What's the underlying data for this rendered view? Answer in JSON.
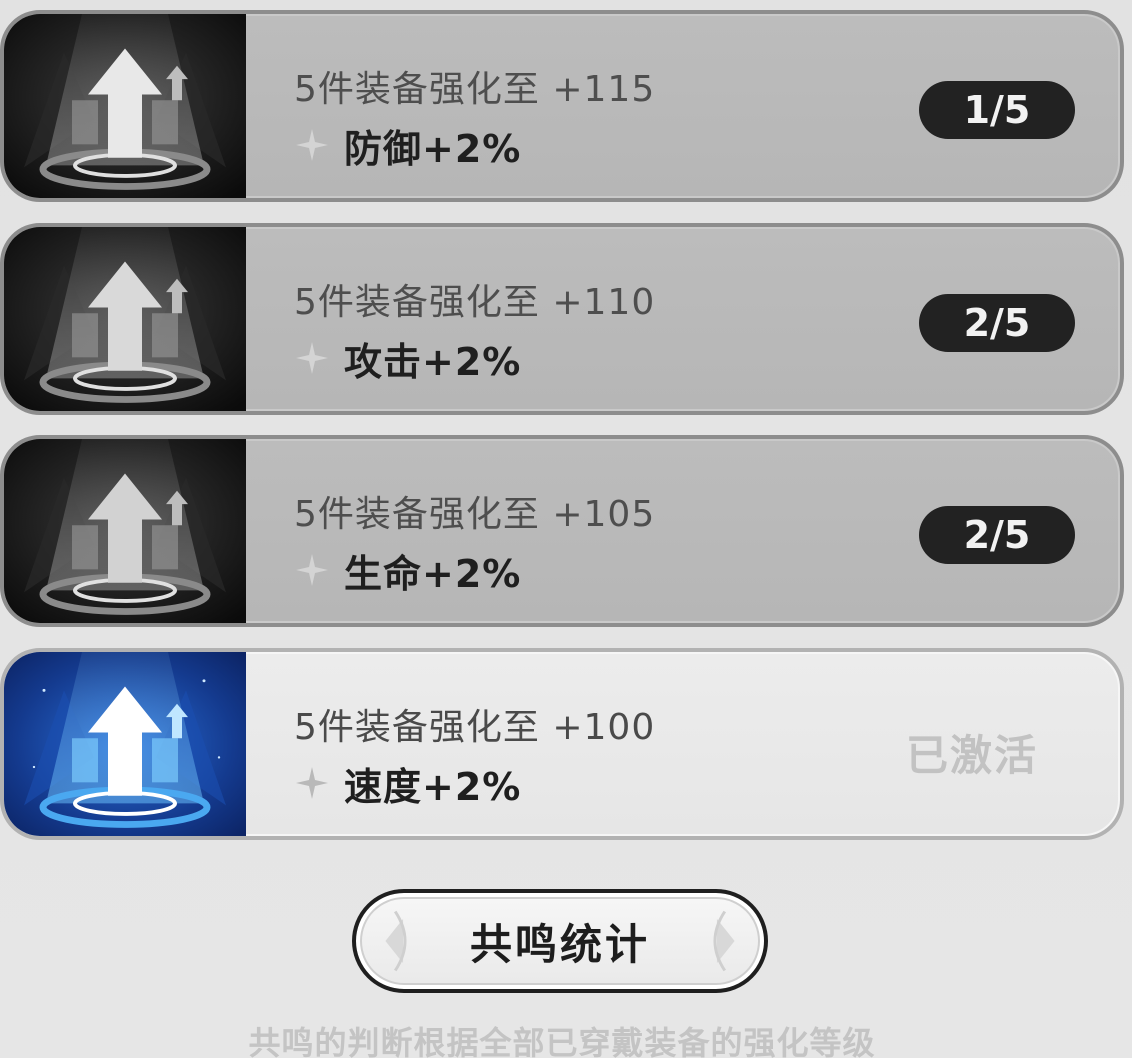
{
  "resonance": {
    "tiers": [
      {
        "requirement": "5件装备强化至 +115",
        "bonus": "防御+2%",
        "progress": "1/5",
        "progress_fraction": 0.2,
        "state": "locked"
      },
      {
        "requirement": "5件装备强化至 +110",
        "bonus": "攻击+2%",
        "progress": "2/5",
        "progress_fraction": 0.4,
        "state": "locked"
      },
      {
        "requirement": "5件装备强化至 +105",
        "bonus": "生命+2%",
        "progress": "2/5",
        "progress_fraction": 0.4,
        "state": "locked"
      },
      {
        "requirement": "5件装备强化至 +100",
        "bonus": "速度+2%",
        "status": "已激活",
        "state": "active"
      }
    ],
    "stats_button_label": "共鸣统计",
    "footnote": "共鸣的判断根据全部已穿戴装备的强化等级",
    "icons": {
      "locked": "upgrade-arrow-icon-gray",
      "active": "upgrade-arrow-icon-blue",
      "bullet": "sparkle-icon"
    },
    "colors": {
      "locked_icon_bg": "#1a1a1a",
      "active_icon_bg": "#123a8c",
      "pill_bg": "#222222",
      "activated_text": "#c2c2c2"
    }
  }
}
